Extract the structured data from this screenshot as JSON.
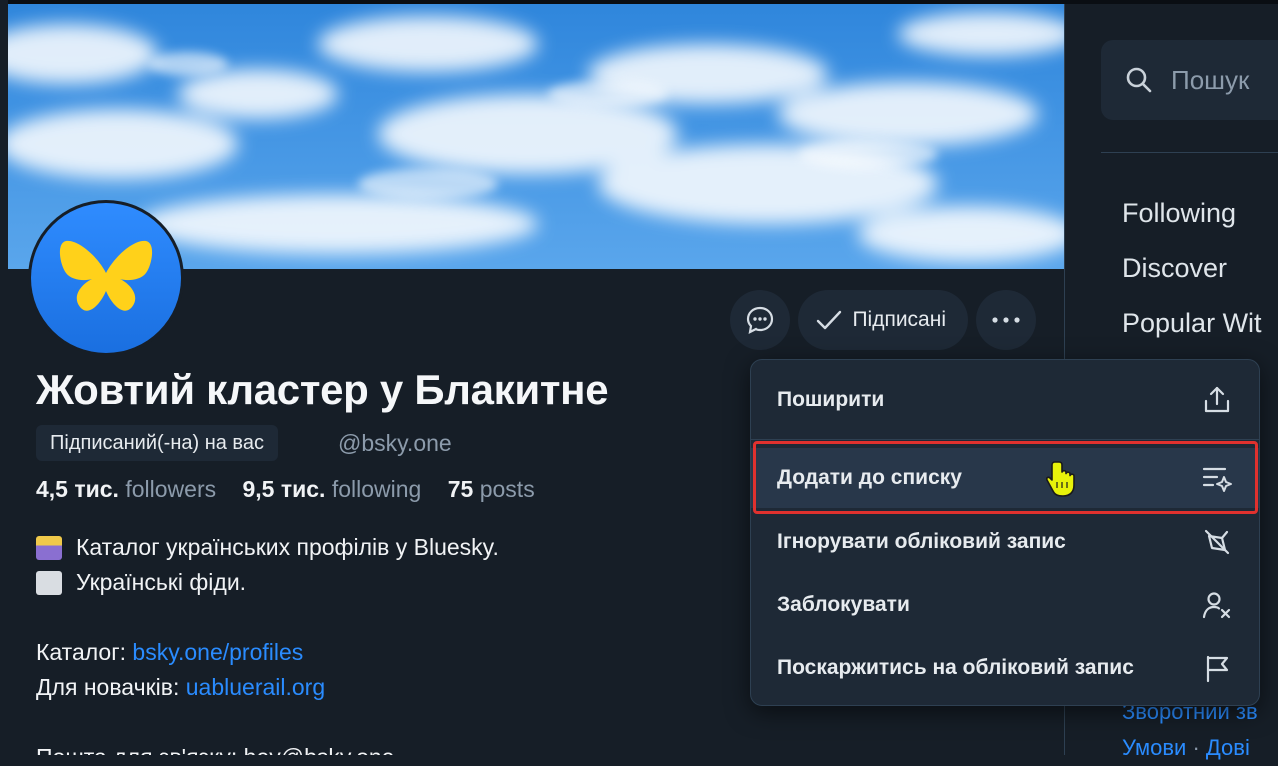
{
  "profile": {
    "display_name": "Жовтий кластер у Блакитне",
    "follows_you_label": "Підписаний(-на) на вас",
    "handle": "@bsky.one",
    "followers_count": "4,5 тис.",
    "followers_label": "followers",
    "following_count": "9,5 тис.",
    "following_label": "following",
    "posts_count": "75",
    "posts_label": "posts",
    "bio": {
      "line1": "Каталог українських профілів у Bluesky.",
      "line2": "Українські фіди.",
      "catalog_label": "Каталог: ",
      "catalog_link": "bsky.one/profiles",
      "newcomers_label": "Для новачків: ",
      "newcomers_link": "uabluerail.org",
      "contact_line": "Пошта для зв'язку: hey@bsky.one"
    }
  },
  "actions": {
    "subscribed_label": "Підписані",
    "message_icon": "message-icon",
    "more_icon": "more-icon"
  },
  "menu": {
    "items": [
      {
        "label": "Поширити",
        "icon": "share-icon"
      },
      {
        "label": "Додати до списку",
        "icon": "list-add-icon"
      },
      {
        "label": "Ігнорувати обліковий запис",
        "icon": "mute-icon"
      },
      {
        "label": "Заблокувати",
        "icon": "block-user-icon"
      },
      {
        "label": "Поскаржитись на обліковий запис",
        "icon": "flag-icon"
      }
    ]
  },
  "sidebar_right": {
    "search_placeholder": "Пошук",
    "feeds": [
      "Following",
      "Discover",
      "Popular Wit"
    ],
    "footer_line1": "Зворотний зв",
    "footer_terms": "Умови",
    "footer_sep": " · ",
    "footer_privacy": "Дові"
  },
  "colors": {
    "background": "#161e27",
    "surface": "#1e2936",
    "link": "#2a8cff",
    "highlight_box": "#e0312e",
    "cursor": "#e8f20a"
  }
}
